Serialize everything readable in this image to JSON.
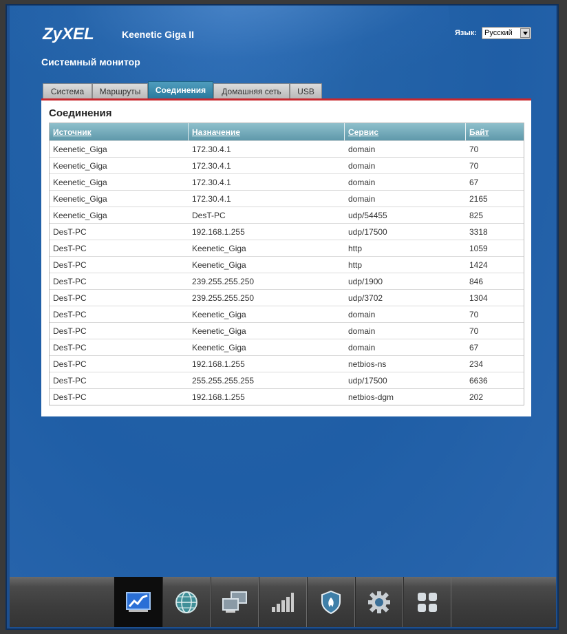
{
  "header": {
    "brand": "ZyXEL",
    "model": "Keenetic Giga II",
    "language_label": "Язык:",
    "language_value": "Русский"
  },
  "page_title": "Системный монитор",
  "tabs": [
    {
      "label": "Система",
      "active": false
    },
    {
      "label": "Маршруты",
      "active": false
    },
    {
      "label": "Соединения",
      "active": true
    },
    {
      "label": "Домашняя сеть",
      "active": false
    },
    {
      "label": "USB",
      "active": false
    }
  ],
  "panel": {
    "title": "Соединения",
    "columns": [
      "Источник",
      "Назначение",
      "Сервис",
      "Байт"
    ],
    "rows": [
      [
        "Keenetic_Giga",
        "172.30.4.1",
        "domain",
        "70"
      ],
      [
        "Keenetic_Giga",
        "172.30.4.1",
        "domain",
        "70"
      ],
      [
        "Keenetic_Giga",
        "172.30.4.1",
        "domain",
        "67"
      ],
      [
        "Keenetic_Giga",
        "172.30.4.1",
        "domain",
        "2165"
      ],
      [
        "Keenetic_Giga",
        "DesT-PC",
        "udp/54455",
        "825"
      ],
      [
        "DesT-PC",
        "192.168.1.255",
        "udp/17500",
        "3318"
      ],
      [
        "DesT-PC",
        "Keenetic_Giga",
        "http",
        "1059"
      ],
      [
        "DesT-PC",
        "Keenetic_Giga",
        "http",
        "1424"
      ],
      [
        "DesT-PC",
        "239.255.255.250",
        "udp/1900",
        "846"
      ],
      [
        "DesT-PC",
        "239.255.255.250",
        "udp/3702",
        "1304"
      ],
      [
        "DesT-PC",
        "Keenetic_Giga",
        "domain",
        "70"
      ],
      [
        "DesT-PC",
        "Keenetic_Giga",
        "domain",
        "70"
      ],
      [
        "DesT-PC",
        "Keenetic_Giga",
        "domain",
        "67"
      ],
      [
        "DesT-PC",
        "192.168.1.255",
        "netbios-ns",
        "234"
      ],
      [
        "DesT-PC",
        "255.255.255.255",
        "udp/17500",
        "6636"
      ],
      [
        "DesT-PC",
        "192.168.1.255",
        "netbios-dgm",
        "202"
      ]
    ]
  },
  "taskbar": [
    {
      "icon": "monitor-chart-icon",
      "active": true
    },
    {
      "icon": "globe-icon",
      "active": false
    },
    {
      "icon": "network-computers-icon",
      "active": false
    },
    {
      "icon": "signal-bars-icon",
      "active": false
    },
    {
      "icon": "shield-icon",
      "active": false
    },
    {
      "icon": "gear-icon",
      "active": false
    },
    {
      "icon": "apps-grid-icon",
      "active": false
    }
  ]
}
